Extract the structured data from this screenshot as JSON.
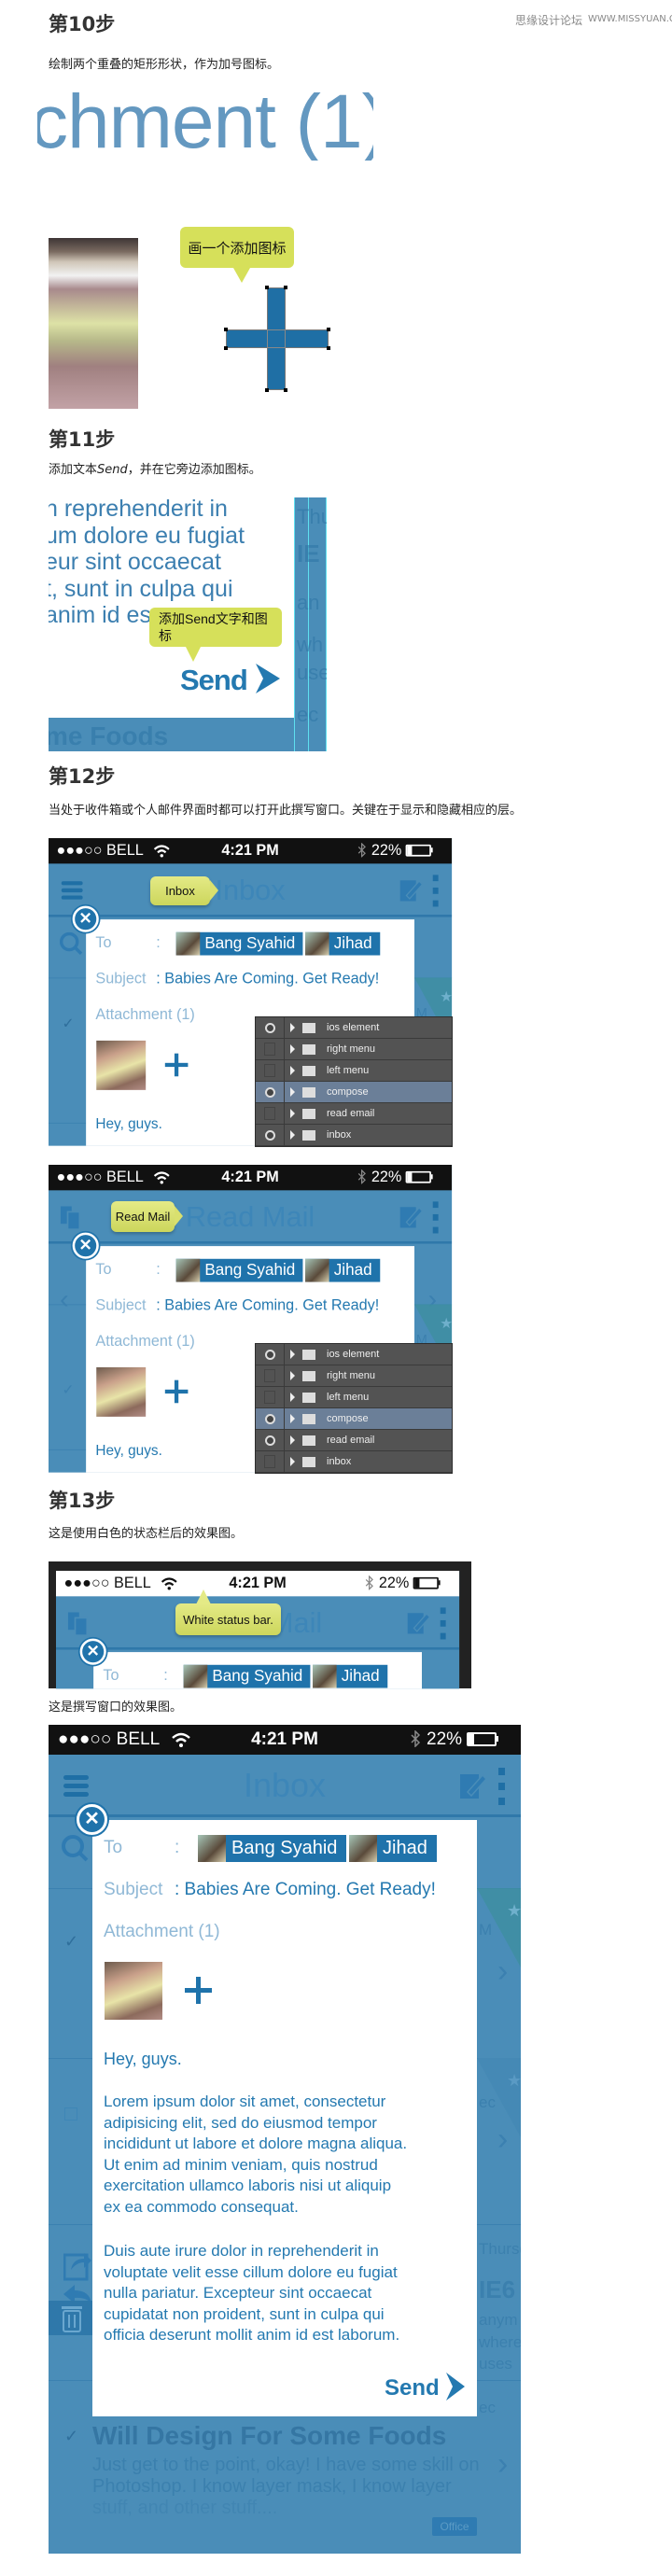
{
  "watermark": {
    "cn": "思缘设计论坛",
    "url": "WWW.MISSYUAN.COM"
  },
  "steps": {
    "s10": {
      "title": "第10步",
      "desc": "绘制两个重叠的矩形形状，作为加号图标。"
    },
    "s11": {
      "title": "第11步",
      "desc_pre": "添加文本",
      "desc_em": "Send",
      "desc_post": "，并在它旁边添加图标。"
    },
    "s12": {
      "title": "第12步",
      "desc": "当处于收件箱或个人邮件界面时都可以打开此撰写窗口。关键在于显示和隐藏相应的层。"
    },
    "s13": {
      "title": "第13步",
      "desc": "这是使用白色的状态栏后的效果图。",
      "desc2": "这是撰写窗口的效果图。"
    }
  },
  "step10": {
    "zoom_text": "chment (1)",
    "tooltip": "画一个添加图标",
    "plus_color": "#1f6fa5"
  },
  "step11": {
    "lines": [
      "n reprehenderit in",
      "um dolore eu fugiat",
      "eur sint occaecat",
      "t, sunt in culpa qui",
      "anim id es"
    ],
    "tooltip": "添加Send文字和图标",
    "send": "Send",
    "footer": "me Foods",
    "strip": [
      "Thu",
      "IE",
      "an",
      "wh",
      "use",
      "ec"
    ]
  },
  "status": {
    "carrier": "●●●○○ BELL",
    "time": "4:21 PM",
    "battery": "22%",
    "battery_level": 0.22
  },
  "compose": {
    "to_label": "To",
    "recipients": [
      "Bang Syahid",
      "Jihad"
    ],
    "subject_label": "Subject",
    "subject": ": Babies Are Coming. Get Ready!",
    "attachment": "Attachment (1)",
    "greeting": "Hey, guys.",
    "body": [
      [
        "Lorem ipsum dolor sit amet, consectetur",
        "adipisicing elit, sed do eiusmod tempor",
        "incididunt ut labore et dolore magna aliqua.",
        "Ut enim ad minim veniam, quis nostrud",
        "exercitation ullamco laboris nisi ut aliquip",
        "ex ea commodo consequat."
      ],
      [
        "Duis aute irure dolor in reprehenderit in",
        "voluptate velit esse cillum dolore eu fugiat",
        "nulla pariatur. Excepteur sint occaecat",
        "cupidatat non proident, sunt in culpa qui",
        "officia deserunt mollit anim id est laborum."
      ]
    ],
    "send": "Send"
  },
  "phones": [
    {
      "title": "Inbox",
      "tooltip": "Inbox",
      "variant": "inbox",
      "status_style": "dark"
    },
    {
      "title": "Read Mail",
      "tooltip": "Read Mail",
      "variant": "read",
      "status_style": "dark"
    },
    {
      "title": "Read Mail",
      "tooltip": "White status bar.",
      "variant": "read",
      "status_style": "white"
    },
    {
      "title": "Inbox",
      "variant": "inbox",
      "status_style": "dark"
    }
  ],
  "layers_panels": [
    [
      {
        "name": "ios element",
        "visible": true
      },
      {
        "name": "right menu",
        "visible": false
      },
      {
        "name": "left menu",
        "visible": false
      },
      {
        "name": "compose",
        "visible": true,
        "selected": true
      },
      {
        "name": "read email",
        "visible": false
      },
      {
        "name": "inbox",
        "visible": true
      }
    ],
    [
      {
        "name": "ios element",
        "visible": true
      },
      {
        "name": "right menu",
        "visible": false
      },
      {
        "name": "left menu",
        "visible": false
      },
      {
        "name": "compose",
        "visible": true,
        "selected": true
      },
      {
        "name": "read email",
        "visible": true
      },
      {
        "name": "inbox",
        "visible": false
      }
    ]
  ],
  "background_list": {
    "title": "Will Design For Some Foods",
    "preview": [
      "Just get to the point, okay! I have some skill on",
      "Photoshop. I know layer mask, I know layer",
      "stuff, and other stuff...."
    ],
    "tag": "Office",
    "right_fragments": [
      "M",
      "ec",
      "Thursd",
      "IE6 .",
      "anym",
      "where",
      "uses",
      "ec"
    ]
  },
  "colors": {
    "app_blue": "#4a8db8",
    "accent": "#1f73ab",
    "text_blue": "#2479b0",
    "tooltip": "#d6e05a",
    "layer_selected": "#6b7f98"
  }
}
